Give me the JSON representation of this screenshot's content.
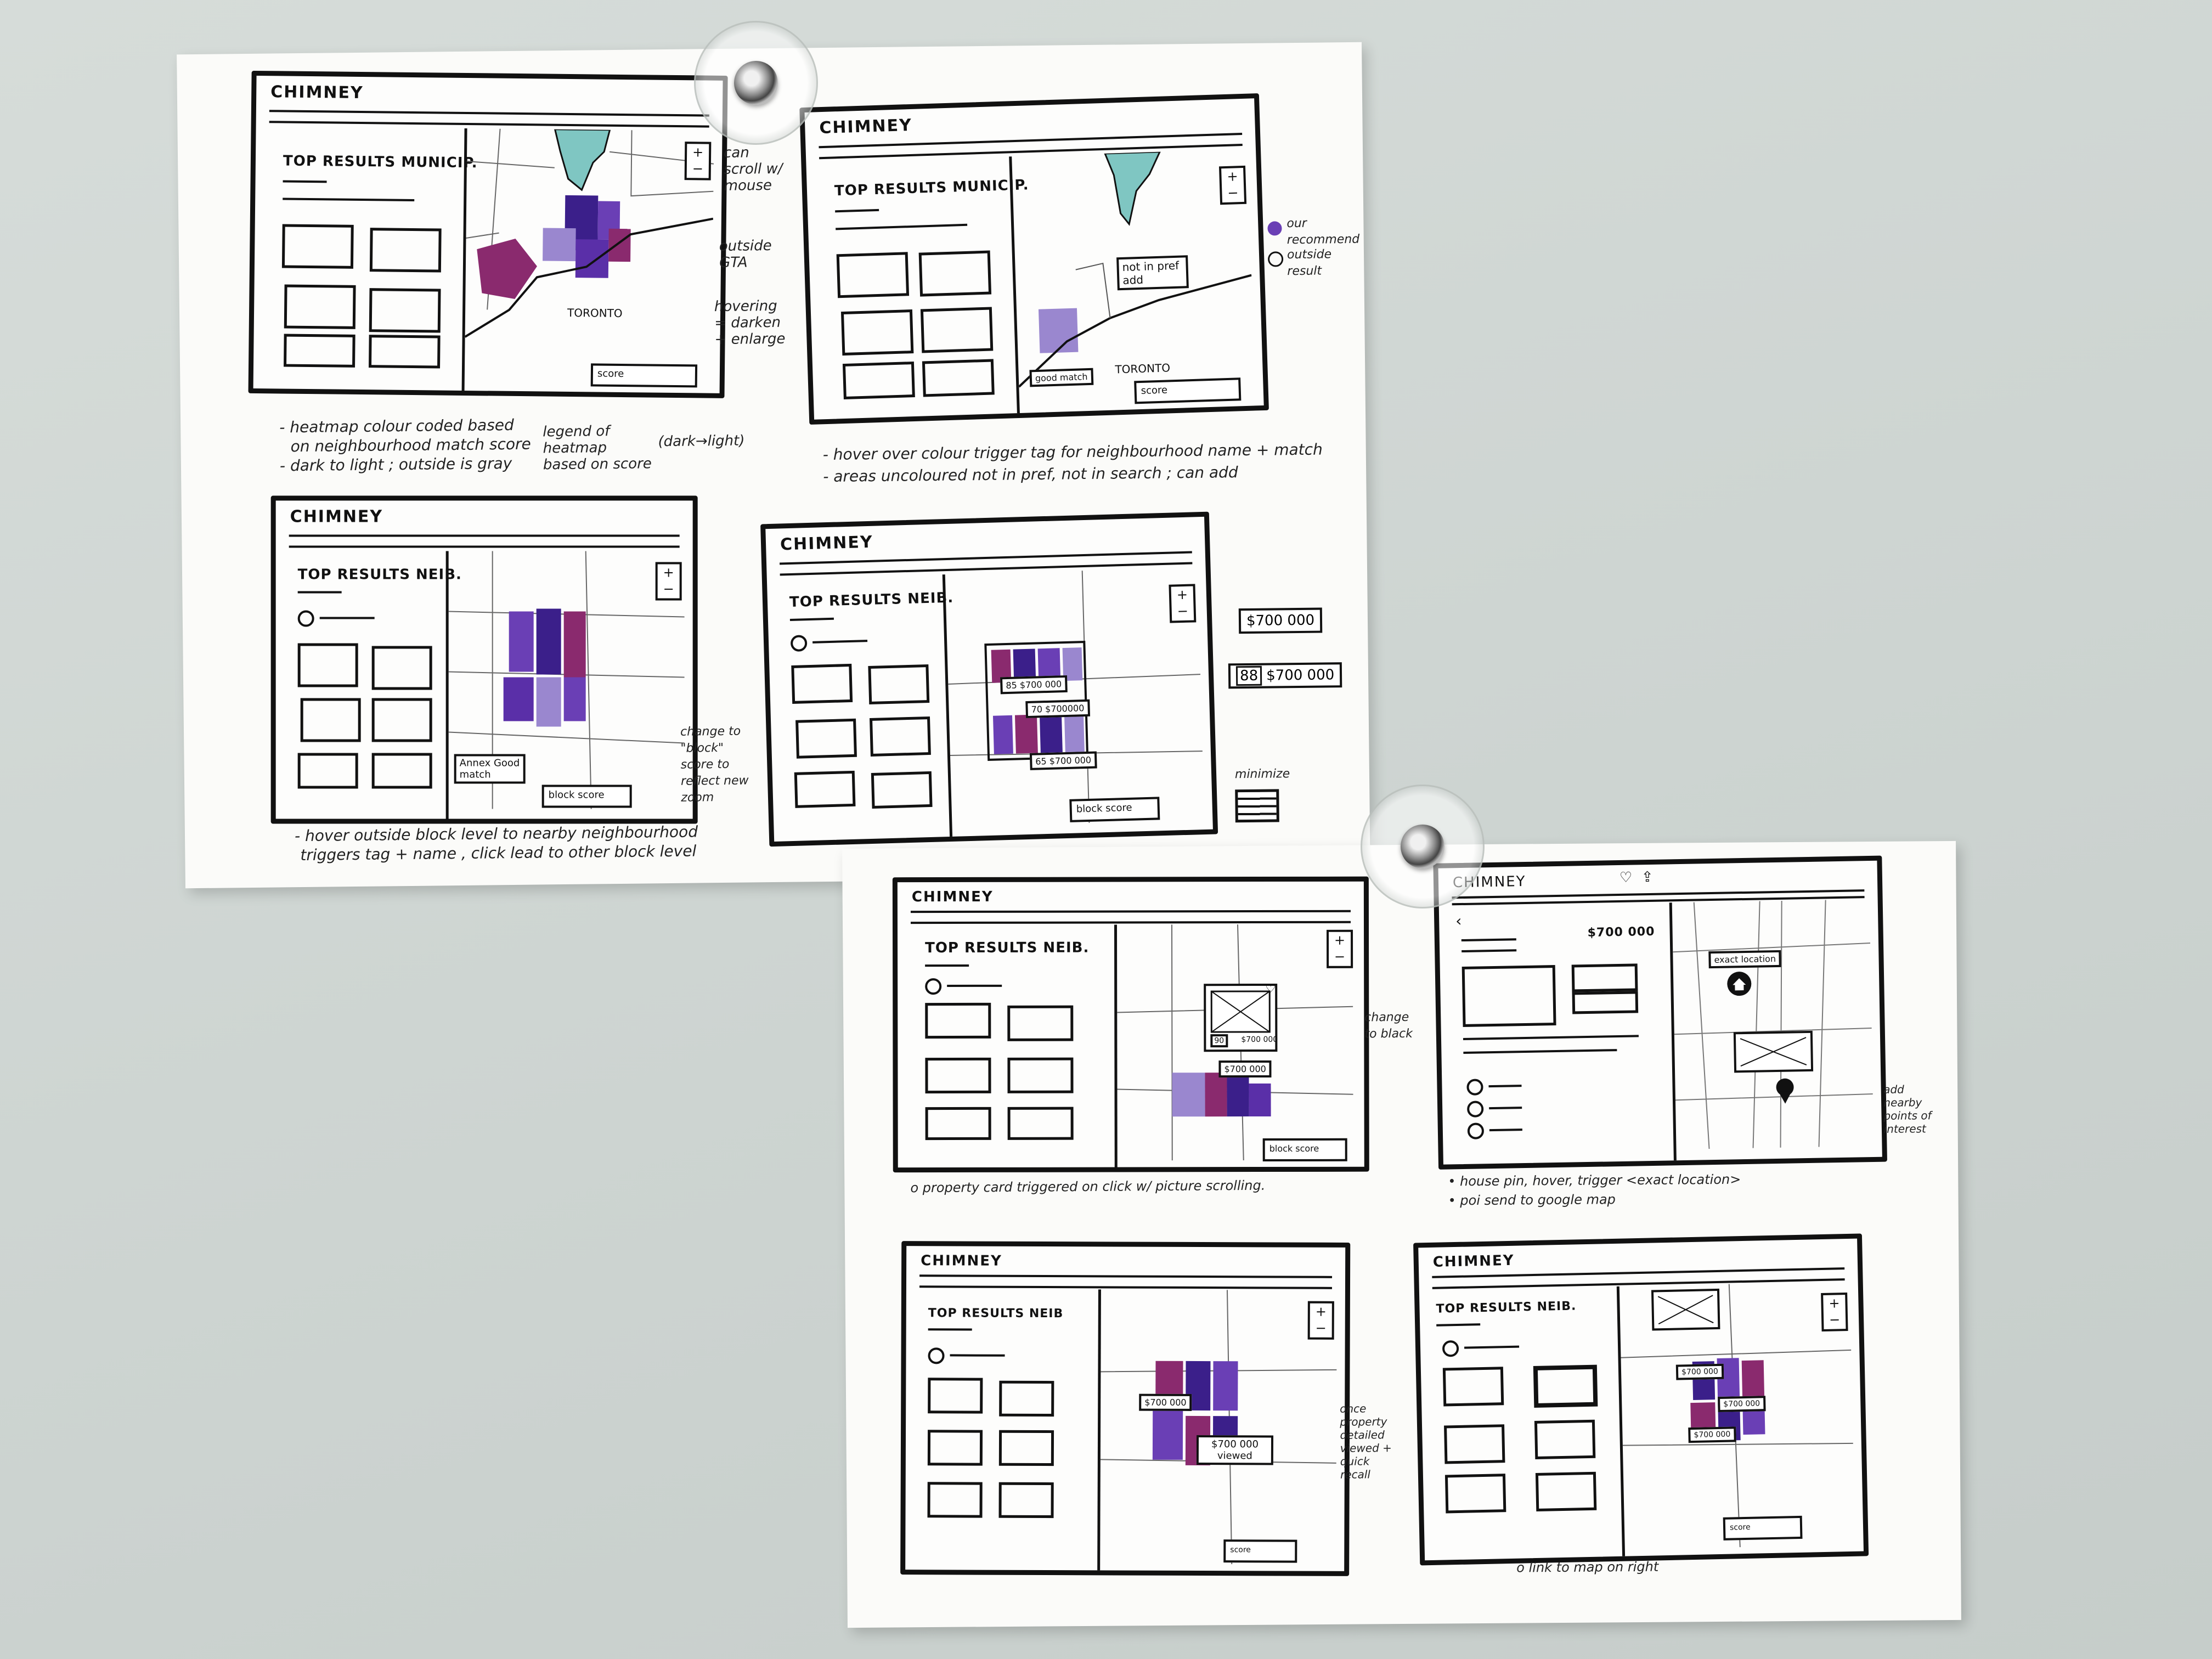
{
  "brand": "CHIMNEY",
  "colors": {
    "dark_purple": "#3b1f8a",
    "mid_purple": "#6a3fb5",
    "light_purple": "#9a87cf",
    "plum": "#8a2a6e",
    "lake": "#7fc6c2",
    "ink": "#111111"
  },
  "icons": [
    "heart-icon",
    "house-pin-icon",
    "zoom-plus-minus-icon",
    "minimize-icon",
    "back-arrow-icon"
  ],
  "sheet1": {
    "panel1": {
      "heading": "TOP RESULTS MUNICIP.",
      "city": "TORONTO",
      "legend": "score",
      "side": [
        "can scroll w/ mouse",
        "outside GTA",
        "hovering = darken + enlarge"
      ],
      "legend_note": "legend of heatmap based on score",
      "legend_note2": "(dark→light)",
      "notes": [
        "- heatmap colour coded based",
        "on neighbourhood match score",
        "- dark to light ; outside is gray"
      ]
    },
    "panel2": {
      "heading": "TOP RESULTS MUNICIP.",
      "city": "TORONTO",
      "tag1": "not in pref add",
      "tag2": "good match",
      "legend": "score",
      "side": [
        "our recommend",
        "outside result"
      ],
      "notes": [
        "- hover over colour trigger tag for neighbourhood name + match",
        "- areas uncoloured not in pref, not in search ; can add"
      ]
    },
    "panel3": {
      "heading": "TOP RESULTS NEIB.",
      "tag": "Annex Good match",
      "legend": "block score",
      "side": [
        "change to \"block\" score to reflect new zoom"
      ],
      "notes": [
        "- hover outside block level to nearby neighbourhood",
        "triggers tag + name , click lead to other block level"
      ]
    },
    "panel4": {
      "heading": "TOP RESULTS NEIB.",
      "price_big": "$700 000",
      "price_score": "88",
      "price_score_value": "$700 000",
      "mini_tags": [
        "85 $700 000",
        "70 $700000",
        "65 $700 000"
      ],
      "legend": "block score",
      "side": [
        "minimize"
      ]
    }
  },
  "sheet2": {
    "panel1": {
      "heading": "TOP RESULTS NEIB.",
      "card_score": "90",
      "card_price": "$700 000",
      "tag": "$700 000",
      "legend": "block score",
      "side": [
        "change to black"
      ],
      "notes": [
        "o property card triggered on click w/ picture scrolling."
      ]
    },
    "panel2": {
      "price": "$700 000",
      "pin_tag": "exact location",
      "side": [
        "add nearby points of interest"
      ],
      "notes": [
        "• house pin, hover, trigger <exact location>",
        "• poi send to google map"
      ]
    },
    "panel3": {
      "heading": "TOP RESULTS NEIB",
      "tag1": "$700 000",
      "tag2": "$700 000 viewed",
      "legend": "score",
      "side": [
        "once property detailed viewed + quick recall"
      ]
    },
    "panel4": {
      "heading": "TOP RESULTS NEIB.",
      "tags": [
        "$700 000",
        "$700 000",
        "$700 000"
      ],
      "legend": "score",
      "notes": [
        "o link to map on right"
      ]
    }
  }
}
